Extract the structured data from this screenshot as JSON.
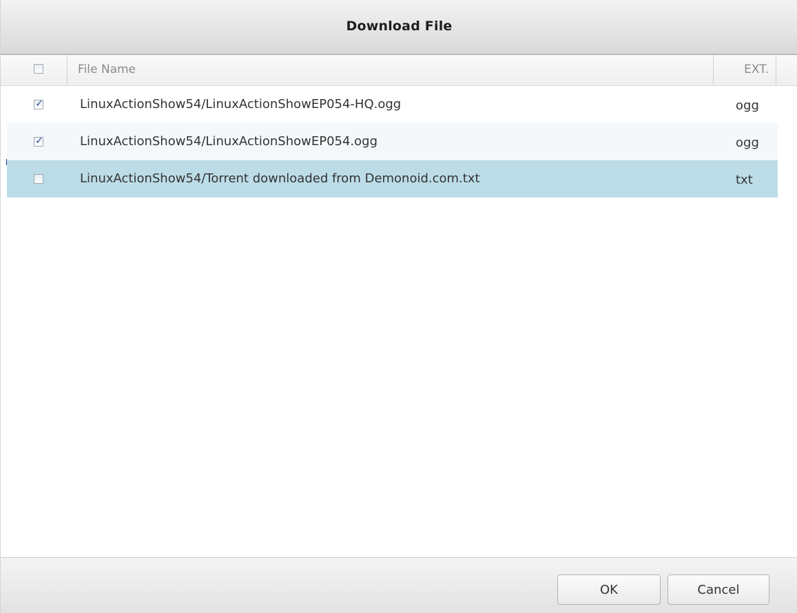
{
  "dialog": {
    "title": "Download File"
  },
  "grid": {
    "columns": {
      "name": "File Name",
      "ext": "EXT."
    },
    "select_all_checked": false,
    "rows": [
      {
        "name": "LinuxActionShow54/LinuxActionShowEP054-HQ.ogg",
        "ext": "ogg",
        "checked": true,
        "selected": false
      },
      {
        "name": "LinuxActionShow54/LinuxActionShowEP054.ogg",
        "ext": "ogg",
        "checked": true,
        "selected": false
      },
      {
        "name": "LinuxActionShow54/Torrent downloaded from Demonoid.com.txt",
        "ext": "txt",
        "checked": false,
        "selected": true
      }
    ]
  },
  "footer": {
    "ok_label": "OK",
    "cancel_label": "Cancel"
  },
  "colors": {
    "selected_row": "#bcdde8",
    "alt_row": "#f5f8fb",
    "checkmark": "#2a4f9e"
  },
  "icons": {
    "checked": "check-icon"
  }
}
